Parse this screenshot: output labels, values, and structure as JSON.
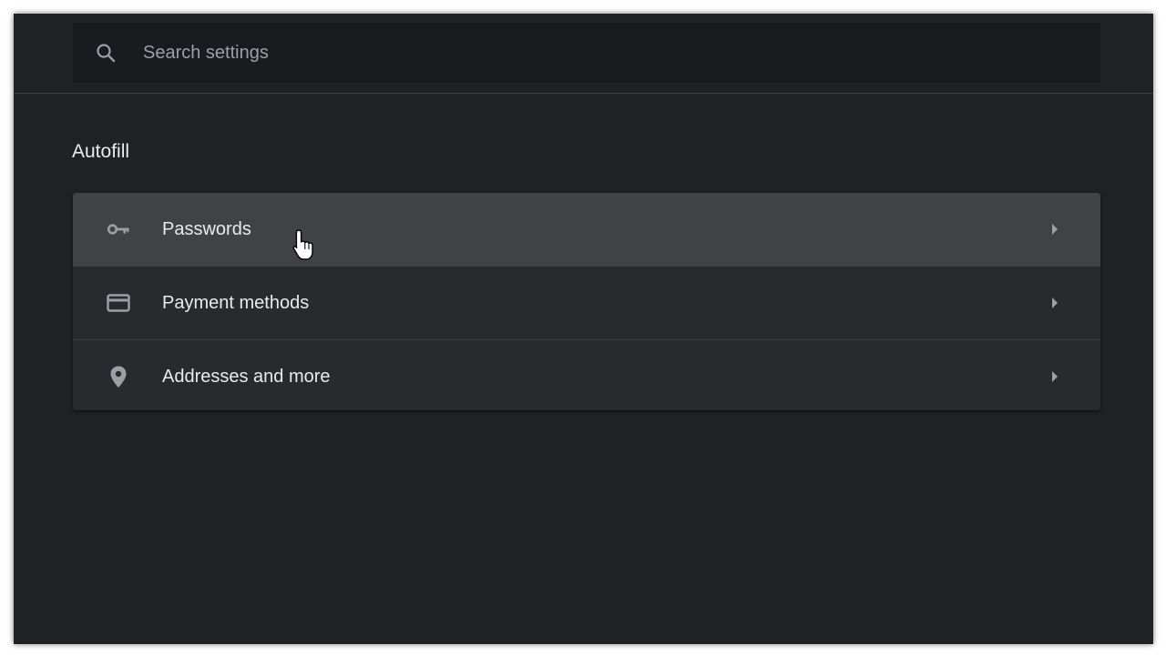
{
  "search": {
    "placeholder": "Search settings",
    "icon": "search-icon"
  },
  "section": {
    "title": "Autofill"
  },
  "autofill_items": [
    {
      "label": "Passwords",
      "icon": "key-icon",
      "hovered": true
    },
    {
      "label": "Payment methods",
      "icon": "credit-card-icon",
      "hovered": false
    },
    {
      "label": "Addresses and more",
      "icon": "location-pin-icon",
      "hovered": false
    }
  ],
  "colors": {
    "background": "#202124",
    "card": "#292a2d",
    "hover_row": "#414245",
    "text": "#e8eaed",
    "icon": "#9aa0a6"
  }
}
